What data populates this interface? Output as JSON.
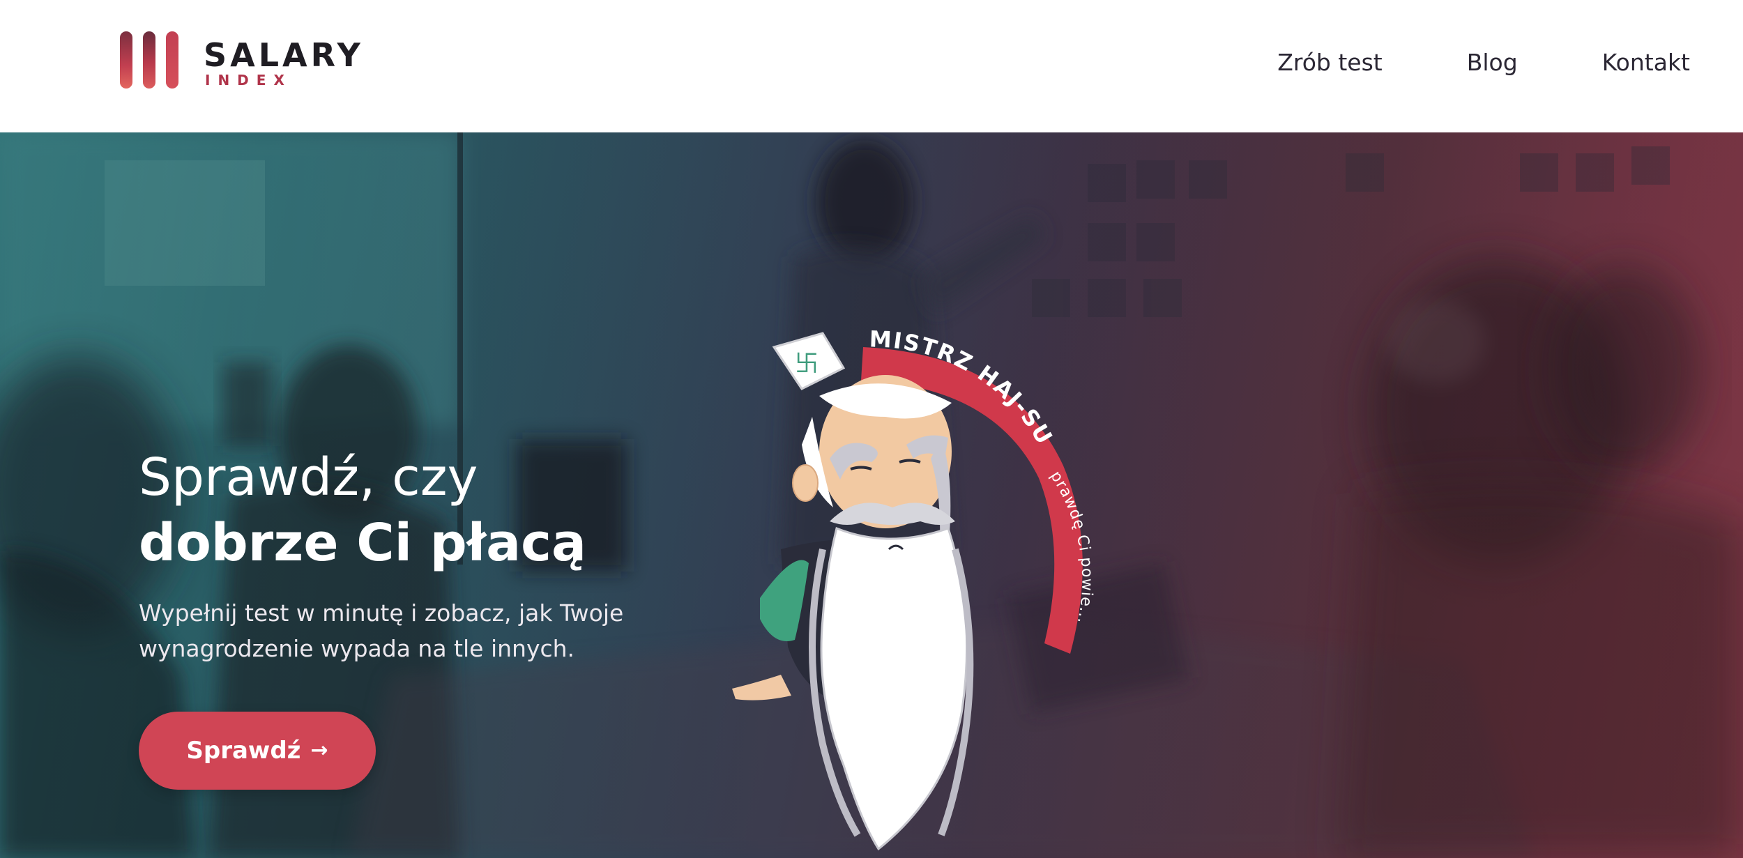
{
  "brand": {
    "name": "SALARY",
    "subtitle": "INDEX",
    "colors": {
      "dark": "#1f1d23",
      "accent": "#d04555",
      "accent_dark": "#b0344a"
    }
  },
  "nav": {
    "items": [
      {
        "label": "Zrób test"
      },
      {
        "label": "Blog"
      },
      {
        "label": "Kontakt"
      }
    ]
  },
  "hero": {
    "title_line1": "Sprawdź, czy",
    "title_line2": "dobrze Ci płacą",
    "subtitle": "Wypełnij test w minutę i zobacz, jak Twoje wynagrodzenie wypada na tle innych.",
    "cta_label": "Sprawdź",
    "cta_icon": "arrow-right-icon",
    "gradient_colors": [
      "#3e8f92",
      "#333f53",
      "#8f3d4c"
    ]
  },
  "mascot": {
    "banner_big": "MISTRZ HAJ-SU",
    "banner_small": "prawdę Ci powie...",
    "scroll_glyph": "卐"
  }
}
